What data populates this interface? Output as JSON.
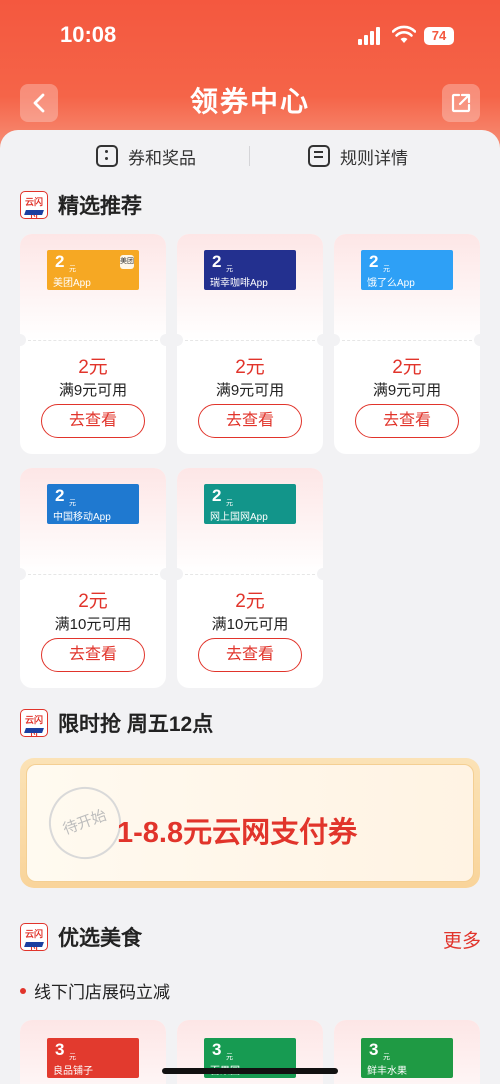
{
  "status_bar": {
    "time": "10:08",
    "battery": "74"
  },
  "header": {
    "title": "领券中心"
  },
  "top_tabs": {
    "prizes": "券和奖品",
    "rules": "规则详情"
  },
  "logo_text": "云闪付",
  "section_featured": {
    "title": "精选推荐",
    "cards": [
      {
        "ticket_amount": "2",
        "ticket_unit": "元",
        "app": "美团App",
        "badge": "美团",
        "price": "2元",
        "condition": "满9元可用",
        "button": "去查看",
        "color": "#f6a823"
      },
      {
        "ticket_amount": "2",
        "ticket_unit": "元",
        "app": "瑞幸咖啡App",
        "badge": "",
        "price": "2元",
        "condition": "满9元可用",
        "button": "去查看",
        "color": "#23308f"
      },
      {
        "ticket_amount": "2",
        "ticket_unit": "元",
        "app": "饿了么App",
        "badge": "",
        "price": "2元",
        "condition": "满9元可用",
        "button": "去查看",
        "color": "#2ea0f6"
      },
      {
        "ticket_amount": "2",
        "ticket_unit": "元",
        "app": "中国移动App",
        "badge": "",
        "price": "2元",
        "condition": "满10元可用",
        "button": "去查看",
        "color": "#1f79d0"
      },
      {
        "ticket_amount": "2",
        "ticket_unit": "元",
        "app": "网上国网App",
        "badge": "",
        "price": "2元",
        "condition": "满10元可用",
        "button": "去查看",
        "color": "#12958a"
      }
    ]
  },
  "section_flash": {
    "title": "限时抢 周五12点",
    "stamp": "待开始",
    "coupon": "1-8.8元云网支付券"
  },
  "section_food": {
    "title": "优选美食",
    "more": "更多",
    "subtitle": "线下门店展码立减",
    "cards": [
      {
        "ticket_amount": "3",
        "ticket_unit": "元",
        "name": "良品铺子",
        "color": "#e23a2e"
      },
      {
        "ticket_amount": "3",
        "ticket_unit": "元",
        "name": "百果园",
        "color": "#179b52"
      },
      {
        "ticket_amount": "3",
        "ticket_unit": "元",
        "name": "鲜丰水果",
        "color": "#1f9a44"
      }
    ]
  }
}
